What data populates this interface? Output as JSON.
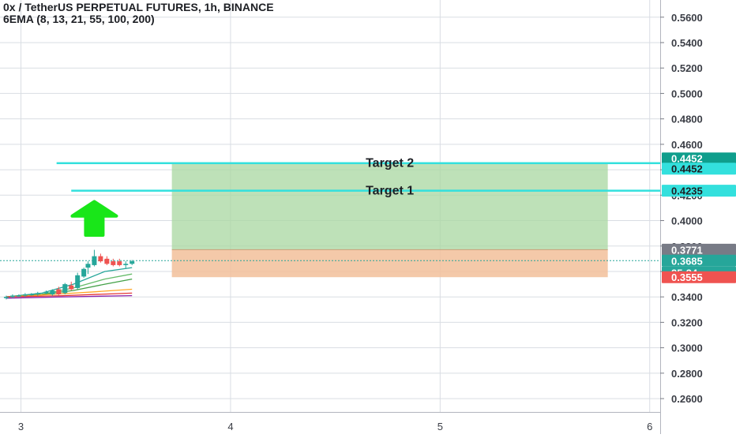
{
  "header": {
    "title": "0x / TetherUS PERPETUAL FUTURES, 1h, BINANCE",
    "indicator": "6EMA (8, 13, 21, 55, 100, 200)"
  },
  "colors": {
    "grid": "#d9dde3",
    "up": "#26a69a",
    "down": "#ef5350",
    "target_line": "#33e0dd",
    "profit_zone": "#a8d7a0",
    "loss_zone": "#f2c09a",
    "arrow": "#19e619",
    "axis_text": "#3a3d45"
  },
  "chart_data": {
    "type": "candlestick",
    "title": "0x / TetherUS PERPETUAL FUTURES, 1h, BINANCE",
    "x_ticks": [
      "3",
      "4",
      "5",
      "6"
    ],
    "x_tick_values": [
      3,
      4,
      5,
      6
    ],
    "xlim": [
      2.9,
      6.05
    ],
    "y_ticks": [
      "0.2600",
      "0.2800",
      "0.3000",
      "0.3200",
      "0.3400",
      "0.3600",
      "0.3800",
      "0.4000",
      "0.4200",
      "0.4400",
      "0.4600",
      "0.4800",
      "0.5000",
      "0.5200",
      "0.5400",
      "0.5600"
    ],
    "y_tick_values": [
      0.26,
      0.28,
      0.3,
      0.32,
      0.34,
      0.36,
      0.38,
      0.4,
      0.42,
      0.44,
      0.46,
      0.48,
      0.5,
      0.52,
      0.54,
      0.56
    ],
    "ylim": [
      0.2495,
      0.5735
    ],
    "candles": [
      {
        "x": 2.93,
        "open": 0.339,
        "high": 0.341,
        "low": 0.338,
        "close": 0.34
      },
      {
        "x": 2.96,
        "open": 0.34,
        "high": 0.342,
        "low": 0.339,
        "close": 0.341
      },
      {
        "x": 2.99,
        "open": 0.341,
        "high": 0.342,
        "low": 0.34,
        "close": 0.341
      },
      {
        "x": 3.02,
        "open": 0.341,
        "high": 0.343,
        "low": 0.34,
        "close": 0.342
      },
      {
        "x": 3.05,
        "open": 0.342,
        "high": 0.343,
        "low": 0.341,
        "close": 0.342
      },
      {
        "x": 3.08,
        "open": 0.342,
        "high": 0.344,
        "low": 0.341,
        "close": 0.343
      },
      {
        "x": 3.12,
        "open": 0.343,
        "high": 0.345,
        "low": 0.342,
        "close": 0.344
      },
      {
        "x": 3.15,
        "open": 0.342,
        "high": 0.346,
        "low": 0.341,
        "close": 0.345
      },
      {
        "x": 3.18,
        "open": 0.346,
        "high": 0.348,
        "low": 0.341,
        "close": 0.342
      },
      {
        "x": 3.21,
        "open": 0.343,
        "high": 0.351,
        "low": 0.342,
        "close": 0.35
      },
      {
        "x": 3.24,
        "open": 0.349,
        "high": 0.352,
        "low": 0.345,
        "close": 0.346
      },
      {
        "x": 3.27,
        "open": 0.347,
        "high": 0.359,
        "low": 0.346,
        "close": 0.357
      },
      {
        "x": 3.3,
        "open": 0.356,
        "high": 0.363,
        "low": 0.355,
        "close": 0.362
      },
      {
        "x": 3.32,
        "open": 0.363,
        "high": 0.368,
        "low": 0.358,
        "close": 0.366
      },
      {
        "x": 3.35,
        "open": 0.365,
        "high": 0.377,
        "low": 0.364,
        "close": 0.372
      },
      {
        "x": 3.38,
        "open": 0.372,
        "high": 0.374,
        "low": 0.367,
        "close": 0.368
      },
      {
        "x": 3.41,
        "open": 0.37,
        "high": 0.372,
        "low": 0.365,
        "close": 0.366
      },
      {
        "x": 3.44,
        "open": 0.368,
        "high": 0.37,
        "low": 0.364,
        "close": 0.365
      },
      {
        "x": 3.47,
        "open": 0.368,
        "high": 0.37,
        "low": 0.364,
        "close": 0.365
      },
      {
        "x": 3.5,
        "open": 0.365,
        "high": 0.368,
        "low": 0.362,
        "close": 0.366
      },
      {
        "x": 3.53,
        "open": 0.366,
        "high": 0.369,
        "low": 0.365,
        "close": 0.368
      }
    ],
    "ema_series": [
      {
        "color": "#26a69a",
        "values": [
          [
            2.93,
            0.34
          ],
          [
            3.1,
            0.343
          ],
          [
            3.25,
            0.35
          ],
          [
            3.4,
            0.36
          ],
          [
            3.53,
            0.363
          ]
        ]
      },
      {
        "color": "#66bb6a",
        "values": [
          [
            2.93,
            0.34
          ],
          [
            3.1,
            0.342
          ],
          [
            3.25,
            0.347
          ],
          [
            3.4,
            0.354
          ],
          [
            3.53,
            0.358
          ]
        ]
      },
      {
        "color": "#43a047",
        "values": [
          [
            2.93,
            0.34
          ],
          [
            3.1,
            0.342
          ],
          [
            3.25,
            0.345
          ],
          [
            3.4,
            0.35
          ],
          [
            3.53,
            0.354
          ]
        ]
      },
      {
        "color": "#ffa726",
        "values": [
          [
            2.93,
            0.34
          ],
          [
            3.15,
            0.342
          ],
          [
            3.35,
            0.344
          ],
          [
            3.53,
            0.346
          ]
        ]
      },
      {
        "color": "#e53935",
        "values": [
          [
            2.93,
            0.34
          ],
          [
            3.2,
            0.341
          ],
          [
            3.53,
            0.343
          ]
        ]
      },
      {
        "color": "#8e24aa",
        "values": [
          [
            2.93,
            0.339
          ],
          [
            3.2,
            0.34
          ],
          [
            3.53,
            0.341
          ]
        ]
      }
    ],
    "position": {
      "x_start": 3.72,
      "x_end": 5.8,
      "entry": 0.3771,
      "target": 0.4452,
      "stop": 0.3555
    },
    "target_lines": [
      {
        "label": "Target 2",
        "value": 0.4452,
        "x_start": 3.17,
        "x_end": 6.08
      },
      {
        "label": "Target 1",
        "value": 0.4235,
        "x_start": 3.24,
        "x_end": 6.08
      }
    ],
    "current_price": 0.3685,
    "arrow": {
      "direction": "up",
      "x": 3.35,
      "y_base": 0.3885,
      "y_tip": 0.415
    },
    "price_tags": [
      {
        "text": "0.4452",
        "value": 0.4452,
        "bg": "#0f9e8c",
        "fg": "#ffffff",
        "offset": -6
      },
      {
        "text": "0.4452",
        "value": 0.4452,
        "bg": "#33e0dd",
        "fg": "#1d1f24",
        "offset": 7
      },
      {
        "text": "0.4235",
        "value": 0.4235,
        "bg": "#33e0dd",
        "fg": "#1d1f24",
        "offset": 0
      },
      {
        "text": "0.3771",
        "value": 0.3771,
        "bg": "#787b86",
        "fg": "#ffffff",
        "offset": 0
      },
      {
        "text": "0.3685",
        "value": 0.3685,
        "bg": "#26a69a",
        "fg": "#ffffff",
        "offset": 0
      },
      {
        "text": "25:34",
        "value": 0.3685,
        "bg": "#26a69a",
        "fg": "#ffffff",
        "offset": 15
      },
      {
        "text": "0.3555",
        "value": 0.3555,
        "bg": "#ef5350",
        "fg": "#ffffff",
        "offset": 0
      }
    ]
  }
}
